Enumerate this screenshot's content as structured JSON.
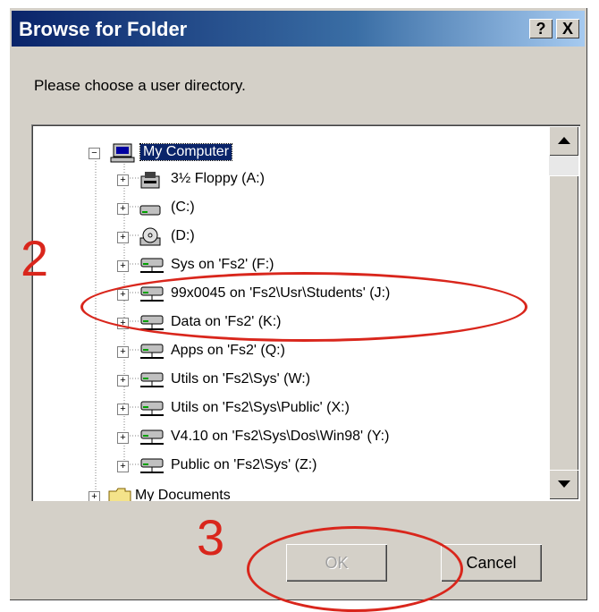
{
  "window": {
    "title": "Browse for Folder",
    "help_label": "?",
    "close_label": "X"
  },
  "prompt": "Please choose a user directory.",
  "tree": {
    "root": {
      "label": "My Computer",
      "expander": "−",
      "icon": "my-computer-icon"
    },
    "items": [
      {
        "label": "3½ Floppy (A:)",
        "icon": "floppy-drive-icon",
        "expander": "+"
      },
      {
        "label": "(C:)",
        "icon": "hard-drive-icon",
        "expander": "+"
      },
      {
        "label": "(D:)",
        "icon": "cd-drive-icon",
        "expander": "+"
      },
      {
        "label": "Sys on 'Fs2' (F:)",
        "icon": "network-drive-icon",
        "expander": "+"
      },
      {
        "label": "99x0045 on 'Fs2\\Usr\\Students' (J:)",
        "icon": "network-drive-icon",
        "expander": "+"
      },
      {
        "label": "Data on 'Fs2' (K:)",
        "icon": "network-drive-icon",
        "expander": "+"
      },
      {
        "label": "Apps on 'Fs2' (Q:)",
        "icon": "network-drive-icon",
        "expander": "+"
      },
      {
        "label": "Utils on 'Fs2\\Sys' (W:)",
        "icon": "network-drive-icon",
        "expander": "+"
      },
      {
        "label": "Utils on 'Fs2\\Sys\\Public' (X:)",
        "icon": "network-drive-icon",
        "expander": "+"
      },
      {
        "label": "V4.10 on 'Fs2\\Sys\\Dos\\Win98' (Y:)",
        "icon": "network-drive-icon",
        "expander": "+"
      },
      {
        "label": "Public on 'Fs2\\Sys' (Z:)",
        "icon": "network-drive-icon",
        "expander": "+"
      }
    ],
    "partial": {
      "label": "My Documents",
      "icon": "folder-icon",
      "expander": "+"
    }
  },
  "buttons": {
    "ok_label": "OK",
    "cancel_label": "Cancel"
  },
  "annotations": {
    "step_2": "2",
    "step_3": "3",
    "color": "#d9261c"
  }
}
